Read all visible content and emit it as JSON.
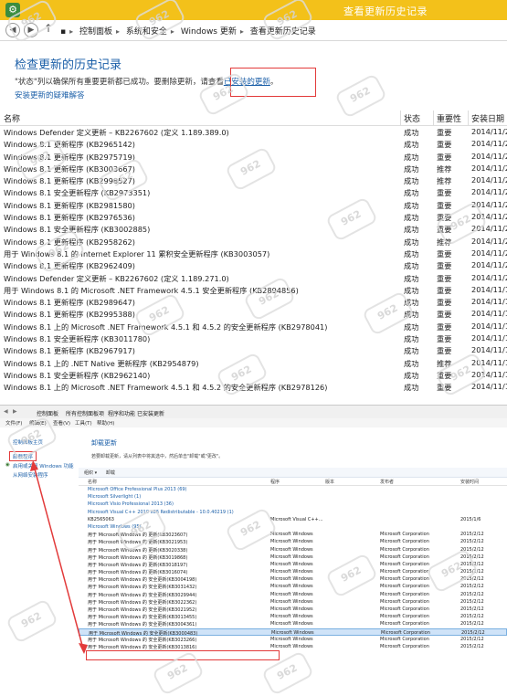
{
  "top": {
    "window_title": "查看更新历史记录",
    "breadcrumb": [
      "控制面板",
      "系统和安全",
      "Windows 更新",
      "查看更新历史记录"
    ],
    "heading": "检查更新的历史记录",
    "description_prefix": "\"状态\"列以确保所有重要更新都已成功。要删除更新，请查看",
    "description_link": "已安装的更新",
    "description_suffix": "。",
    "help_link": "安装更新的疑难解答",
    "columns": {
      "name": "名称",
      "status": "状态",
      "importance": "重要性",
      "date": "安装日期"
    },
    "rows": [
      {
        "name": "Windows Defender 定义更新 – KB2267602 (定义 1.189.389.0)",
        "status": "成功",
        "importance": "重要",
        "date": "2014/11/2"
      },
      {
        "name": "Windows 8.1 更新程序 (KB2965142)",
        "status": "成功",
        "importance": "重要",
        "date": "2014/11/2"
      },
      {
        "name": "Windows 8.1 更新程序 (KB2975719)",
        "status": "成功",
        "importance": "重要",
        "date": "2014/11/2"
      },
      {
        "name": "Windows 8.1 更新程序 (KB3003667)",
        "status": "成功",
        "importance": "推荐",
        "date": "2014/11/2"
      },
      {
        "name": "Windows 8.1 更新程序 (KB2998527)",
        "status": "成功",
        "importance": "推荐",
        "date": "2014/11/2"
      },
      {
        "name": "Windows 8.1 安全更新程序 (KB2973351)",
        "status": "成功",
        "importance": "重要",
        "date": "2014/11/2"
      },
      {
        "name": "Windows 8.1 更新程序 (KB2981580)",
        "status": "成功",
        "importance": "重要",
        "date": "2014/11/2"
      },
      {
        "name": "Windows 8.1 更新程序 (KB2976536)",
        "status": "成功",
        "importance": "重要",
        "date": "2014/11/2"
      },
      {
        "name": "Windows 8.1 安全更新程序 (KB3002885)",
        "status": "成功",
        "importance": "重要",
        "date": "2014/11/2"
      },
      {
        "name": "Windows 8.1 更新程序 (KB2958262)",
        "status": "成功",
        "importance": "推荐",
        "date": "2014/11/2"
      },
      {
        "name": "用于 Windows 8.1 的 Internet Explorer 11 累积安全更新程序 (KB3003057)",
        "status": "成功",
        "importance": "重要",
        "date": "2014/11/2"
      },
      {
        "name": "Windows 8.1 更新程序 (KB2962409)",
        "status": "成功",
        "importance": "重要",
        "date": "2014/11/2"
      },
      {
        "name": "Windows Defender 定义更新 – KB2267602 (定义 1.189.271.0)",
        "status": "成功",
        "importance": "重要",
        "date": "2014/11/2"
      },
      {
        "name": "用于 Windows 8.1 的 Microsoft .NET Framework 4.5.1 安全更新程序 (KB2894856)",
        "status": "成功",
        "importance": "重要",
        "date": "2014/11/1"
      },
      {
        "name": "Windows 8.1 更新程序 (KB2989647)",
        "status": "成功",
        "importance": "重要",
        "date": "2014/11/1"
      },
      {
        "name": "Windows 8.1 更新程序 (KB2995388)",
        "status": "成功",
        "importance": "重要",
        "date": "2014/11/1"
      },
      {
        "name": "Windows 8.1 上的 Microsoft .NET Framework 4.5.1 和 4.5.2 的安全更新程序 (KB2978041)",
        "status": "成功",
        "importance": "重要",
        "date": "2014/11/1"
      },
      {
        "name": "Windows 8.1 安全更新程序 (KB3011780)",
        "status": "成功",
        "importance": "重要",
        "date": "2014/11/1"
      },
      {
        "name": "Windows 8.1 更新程序 (KB2967917)",
        "status": "成功",
        "importance": "重要",
        "date": "2014/11/1"
      },
      {
        "name": "Windows 8.1 上的 .NET Native 更新程序 (KB2954879)",
        "status": "成功",
        "importance": "推荐",
        "date": "2014/11/1"
      },
      {
        "name": "Windows 8.1 安全更新程序 (KB2962140)",
        "status": "成功",
        "importance": "重要",
        "date": "2014/11/1"
      },
      {
        "name": "Windows 8.1 上的 Microsoft .NET Framework 4.5.1 和 4.5.2 的安全更新程序 (KB2978126)",
        "status": "成功",
        "importance": "重要",
        "date": "2014/11/1"
      }
    ]
  },
  "bottom": {
    "address": [
      "控制面板",
      "所有控制面板项",
      "程序和功能",
      "已安装更新"
    ],
    "menu": [
      "文件(F)",
      "编辑(E)",
      "查看(V)",
      "工具(T)",
      "帮助(H)"
    ],
    "sidebar": [
      "控制面板主页",
      "卸载程序",
      "启用或关闭 Windows 功能",
      "从网络安装程序"
    ],
    "title": "卸载更新",
    "desc": "若要卸载更新，请从列表中将其选中，然后单击\"卸载\"或\"更改\"。",
    "toolbar": [
      "组织 ▾",
      "卸载"
    ],
    "columns": [
      "名称",
      "程序",
      "版本",
      "发布者",
      "安装时间"
    ],
    "groups": [
      "Microsoft Office Professional Plus 2013 (69)",
      "Microsoft Silverlight (1)",
      "Microsoft Visio Professional 2013 (36)",
      "Microsoft Visual C++ 2010  x86 Redistributable - 10.0.40219 (1)"
    ],
    "vc_row": {
      "name": "KB2565063",
      "program": "Microsoft Visual C++...",
      "date": "2015/1/6"
    },
    "windows_group": "Microsoft Windows (95)",
    "win_rows": [
      {
        "name": "用于 Microsoft Windows 的 更新(KB3023607)",
        "date": "2015/2/12"
      },
      {
        "name": "用于 Microsoft Windows 的 更新(KB3021953)",
        "date": "2015/2/12"
      },
      {
        "name": "用于 Microsoft Windows 的 更新(KB3020338)",
        "date": "2015/2/12"
      },
      {
        "name": "用于 Microsoft Windows 的 更新(KB3019868)",
        "date": "2015/2/12"
      },
      {
        "name": "用于 Microsoft Windows 的 更新(KB3018197)",
        "date": "2015/2/12"
      },
      {
        "name": "用于 Microsoft Windows 的 更新(KB3016074)",
        "date": "2015/2/12"
      },
      {
        "name": "用于 Microsoft Windows 的 安全更新(KB3004198)",
        "date": "2015/2/12"
      },
      {
        "name": "用于 Microsoft Windows 的 安全更新(KB3031432)",
        "date": "2015/2/12"
      },
      {
        "name": "用于 Microsoft Windows 的 安全更新(KB3029944)",
        "date": "2015/2/12"
      },
      {
        "name": "用于 Microsoft Windows 的 安全更新(KB3022362)",
        "date": "2015/2/12"
      },
      {
        "name": "用于 Microsoft Windows 的 安全更新(KB3021952)",
        "date": "2015/2/12"
      },
      {
        "name": "用于 Microsoft Windows 的 安全更新(KB3013455)",
        "date": "2015/2/12"
      },
      {
        "name": "用于 Microsoft Windows 的 安全更新(KB3004361)",
        "date": "2015/2/12"
      },
      {
        "name": "用于 Microsoft Windows 的 安全更新(KB3000483)",
        "date": "2015/2/12"
      },
      {
        "name": "用于 Microsoft Windows 的 安全更新(KB3023266)",
        "date": "2015/2/12"
      },
      {
        "name": "用于 Microsoft Windows 的 安全更新(KB3013816)",
        "date": "2015/2/12"
      }
    ],
    "win_program": "Microsoft Windows",
    "win_publisher": "Microsoft Corporation",
    "selected_index": 13
  },
  "watermark": "962"
}
